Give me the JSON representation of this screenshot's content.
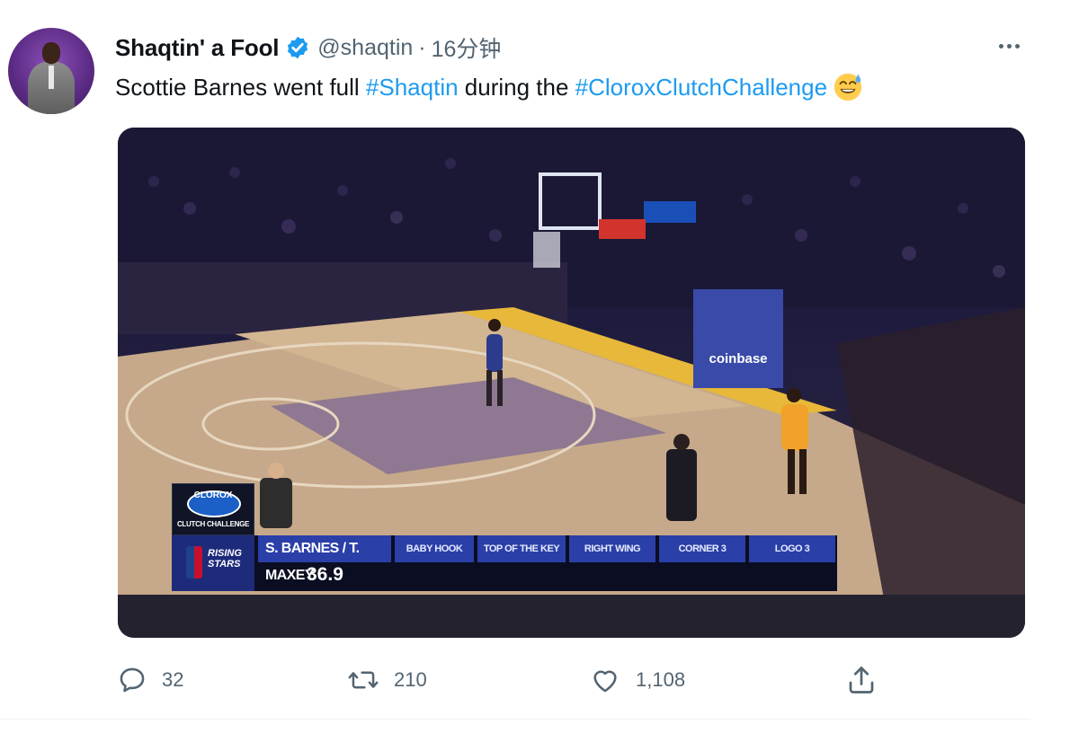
{
  "tweet": {
    "author": {
      "display_name": "Shaqtin' a Fool",
      "handle": "@shaqtin",
      "separator": "·",
      "time": "16分钟",
      "verified": true
    },
    "text": {
      "part1": "Scottie Barnes went full ",
      "hashtag1": "#Shaqtin",
      "part2": " during the ",
      "hashtag2": "#CloroxClutchChallenge",
      "emoji": "sweat-smile-emoji"
    },
    "media": {
      "type": "video-still",
      "arena_sign": "coinbase",
      "scoreboard": {
        "sponsor": "CLOROX",
        "sponsor_caption": "CLUTCH CHALLENGE",
        "event_badge": "RISING STARS",
        "players": "S. BARNES / T. MAXEY",
        "stations": [
          "BABY HOOK",
          "TOP OF THE KEY",
          "RIGHT WING",
          "CORNER 3",
          "LOGO 3"
        ],
        "clock": "36.9"
      }
    },
    "actions": {
      "replies": "32",
      "retweets": "210",
      "likes": "1,108"
    },
    "colors": {
      "accent": "#1d9bf0",
      "secondary_text": "#536471",
      "primary_text": "#0f1419"
    }
  }
}
